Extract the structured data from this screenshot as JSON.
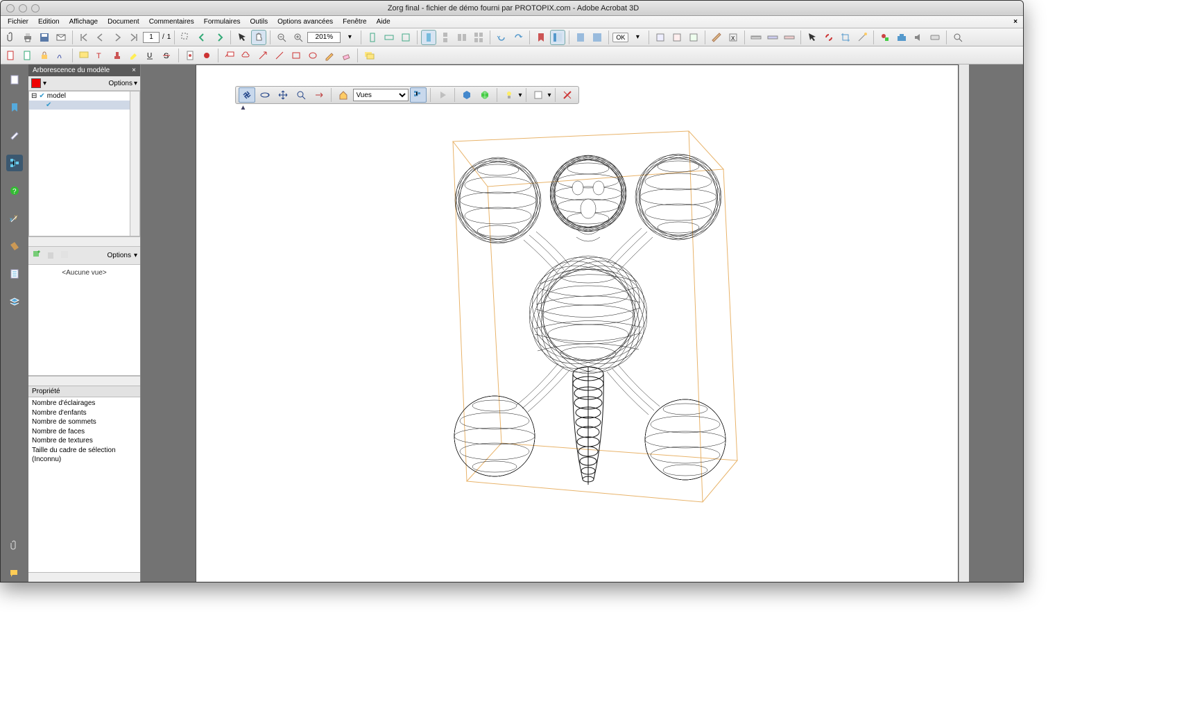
{
  "window": {
    "title": "Zorg final - fichier de démo fourni par PROTOPIX.com - Adobe Acrobat 3D"
  },
  "menubar": {
    "items": [
      "Fichier",
      "Edition",
      "Affichage",
      "Document",
      "Commentaires",
      "Formulaires",
      "Outils",
      "Options avancées",
      "Fenêtre",
      "Aide"
    ]
  },
  "toolbar": {
    "page_current": "1",
    "page_total": "1",
    "zoom": "201%",
    "ok_label": "OK"
  },
  "side": {
    "panel_title": "Arborescence du modèle",
    "options_label": "Options",
    "tree_root": "model",
    "views_options": "Options",
    "no_view": "<Aucune vue>",
    "props_header": "Propriété",
    "props": [
      "Nombre d'éclairages",
      "Nombre d'enfants",
      "Nombre de sommets",
      "Nombre de faces",
      "Nombre de textures",
      "Taille du cadre de sélection (Inconnu)"
    ]
  },
  "viewer": {
    "views_placeholder": "Vues"
  }
}
